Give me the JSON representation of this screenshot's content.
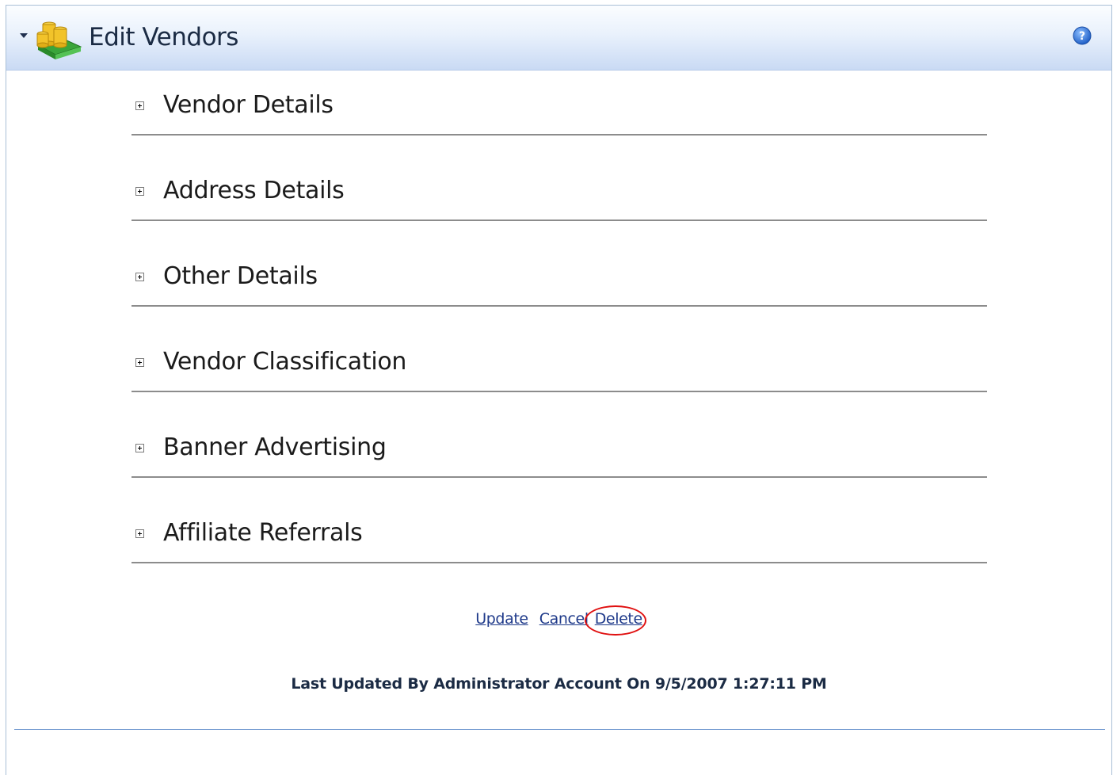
{
  "header": {
    "title": "Edit Vendors",
    "icon": "vendor-coins-icon",
    "help_icon": "help-icon",
    "accent_color": "#c9daf4"
  },
  "sections": [
    {
      "label": "Vendor Details"
    },
    {
      "label": "Address Details"
    },
    {
      "label": "Other Details"
    },
    {
      "label": "Vendor Classification"
    },
    {
      "label": "Banner Advertising"
    },
    {
      "label": "Affiliate Referrals"
    }
  ],
  "actions": {
    "update_label": "Update",
    "cancel_label": "Cancel",
    "delete_label": "Delete",
    "highlight_color": "#e01010"
  },
  "status": {
    "last_updated": "Last Updated By Administrator Account On 9/5/2007 1:27:11 PM"
  }
}
